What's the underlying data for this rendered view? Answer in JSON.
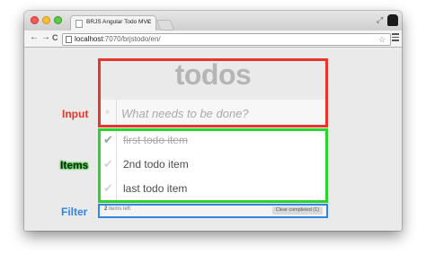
{
  "browser": {
    "tab_title": "BRJS Angular Todo MVC",
    "tab_close": "×",
    "address": {
      "host": "localhost",
      "path": ":7070/brjstodo/en/"
    },
    "nav": {
      "back": "←",
      "forward": "→",
      "reload": "C"
    },
    "star": "☆",
    "fullscreen": "⤢"
  },
  "app": {
    "title": "todos",
    "toggle_all": "»",
    "new_todo_placeholder": "What needs to be done?",
    "todos": [
      {
        "label": "first todo item",
        "completed": true,
        "check": "✔"
      },
      {
        "label": "2nd todo item",
        "completed": false,
        "check": "✔"
      },
      {
        "label": "last todo item",
        "completed": false,
        "check": "✔"
      }
    ],
    "footer": {
      "count": "2",
      "count_suffix": " items left",
      "clear_label": "Clear completed (1)"
    }
  },
  "annotations": {
    "input": "Input",
    "items": "Items",
    "filter": "Filter"
  },
  "colors": {
    "input": "#e8352a",
    "items": "#2bd32b",
    "filter": "#2f86e6"
  }
}
